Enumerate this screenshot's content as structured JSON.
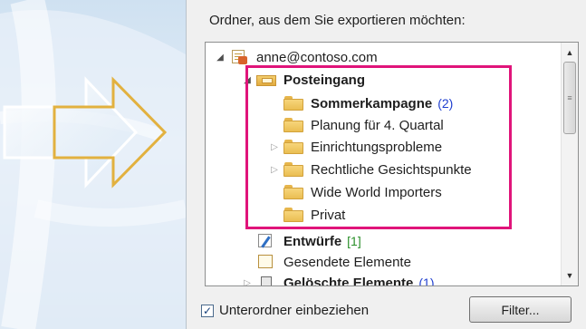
{
  "export": {
    "heading": "Ordner, aus dem Sie exportieren möchten:"
  },
  "tree": {
    "account": {
      "label": "anne@contoso.com",
      "icon": "pst-account-icon"
    },
    "inbox": {
      "label": "Posteingang",
      "icon": "inbox-icon"
    },
    "subfolders": [
      {
        "label": "Sommerkampagne",
        "count": "(2)",
        "bold": true,
        "has_children": false
      },
      {
        "label": "Planung für 4. Quartal",
        "count": "",
        "bold": false,
        "has_children": false
      },
      {
        "label": "Einrichtungsprobleme",
        "count": "",
        "bold": false,
        "has_children": true
      },
      {
        "label": "Rechtliche Gesichtspunkte",
        "count": "",
        "bold": false,
        "has_children": true
      },
      {
        "label": "Wide World Importers",
        "count": "",
        "bold": false,
        "has_children": false
      },
      {
        "label": "Privat",
        "count": "",
        "bold": false,
        "has_children": false
      }
    ],
    "drafts": {
      "label": "Entwürfe",
      "count": "[1]"
    },
    "sent": {
      "label": "Gesendete Elemente"
    },
    "deleted": {
      "label": "Gelöschte Elemente",
      "count": "(1)"
    }
  },
  "options": {
    "include_subfolders_label": "Unterordner einbeziehen",
    "include_subfolders_checked": true,
    "filter_button": "Filter..."
  },
  "colors": {
    "highlight": "#e0147a",
    "unread_count": "#1f3fcf",
    "draft_count": "#2a8f2a",
    "folder": "#eabe52"
  }
}
